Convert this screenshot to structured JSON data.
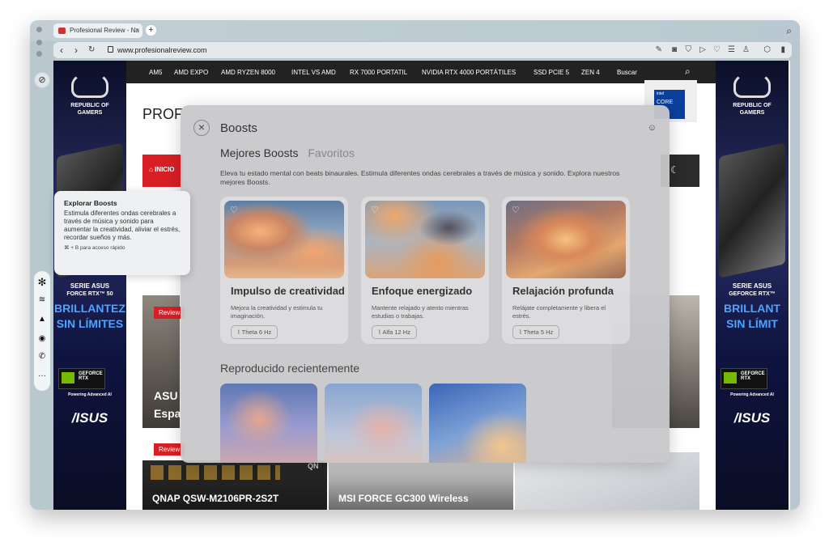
{
  "browser": {
    "tab_title": "Profesional Review - Na",
    "tab_close": "×",
    "new_tab": "+",
    "url": "www.profesionalreview.com"
  },
  "site": {
    "menu": [
      "AM5",
      "AMD EXPO",
      "AMD RYZEN 8000",
      "INTEL VS AMD",
      "RX 7000 PORTATIL",
      "NVIDIA RTX 4000 PORTÁTILES",
      "SSD PCIE 5",
      "ZEN 4",
      "Buscar"
    ],
    "logo_prefix": "PROF",
    "nav_label": "INICIO",
    "review_badge": "Review",
    "card_left_title_1": "ASU",
    "card_left_title_2": "Espa",
    "card1_title": "QNAP QSW-M2106PR-2S2T",
    "card2_title": "MSI FORCE GC300 Wireless",
    "card3_brand": "QN"
  },
  "ad": {
    "brand_line1": "REPUBLIC OF",
    "brand_line2": "GAMERS",
    "left_series": "SERIE ASUS",
    "left_geforce": "FORCE RTX™ 50",
    "left_headline1": "BRILLANTEZ",
    "left_headline2": "SIN LÍMITES",
    "right_series": "SERIE ASUS",
    "right_geforce": "GEFORCE RTX™",
    "right_headline1": "BRILLANT",
    "right_headline2": "SIN LÍMIT",
    "geforce_line1": "GEFORCE",
    "geforce_line2": "RTX",
    "geforce_tag": "Powering Advanced AI",
    "asus": "/ISUS",
    "intel": "intel",
    "core": "CORE"
  },
  "boosts": {
    "title": "Boosts",
    "tab_active": "Mejores Boosts",
    "tab_inactive": "Favoritos",
    "description": "Eleva tu estado mental con beats binaurales. Estimula diferentes ondas cerebrales a través de música y sonido. Explora nuestros mejores Boosts.",
    "cards": [
      {
        "title": "Impulso de creatividad",
        "desc": "Mejora la creatividad y estimula tu imaginación.",
        "badge": "Theta 6 Hz"
      },
      {
        "title": "Enfoque energizado",
        "desc": "Mantente relajado y atento mientras estudias o trabajas.",
        "badge": "Alfa 12 Hz"
      },
      {
        "title": "Relajación profunda",
        "desc": "Relájate completamente y libera el estrés.",
        "badge": "Theta 5 Hz"
      }
    ],
    "recent_title": "Reproducido recientemente"
  },
  "tooltip": {
    "title": "Explorar Boosts",
    "body": "Estimula diferentes ondas cerebrales a través de música y sonido para aumentar la creatividad, aliviar el estrés, recordar sueños y más.",
    "shortcut": "⌘ + B para acceso rápido"
  },
  "icons": {
    "back": "‹",
    "forward": "›",
    "reload": "↻",
    "search": "⌕",
    "moon": "☾",
    "close": "×",
    "smile": "☺",
    "heart": "♡",
    "wave": "⌇",
    "home": "⌂"
  }
}
